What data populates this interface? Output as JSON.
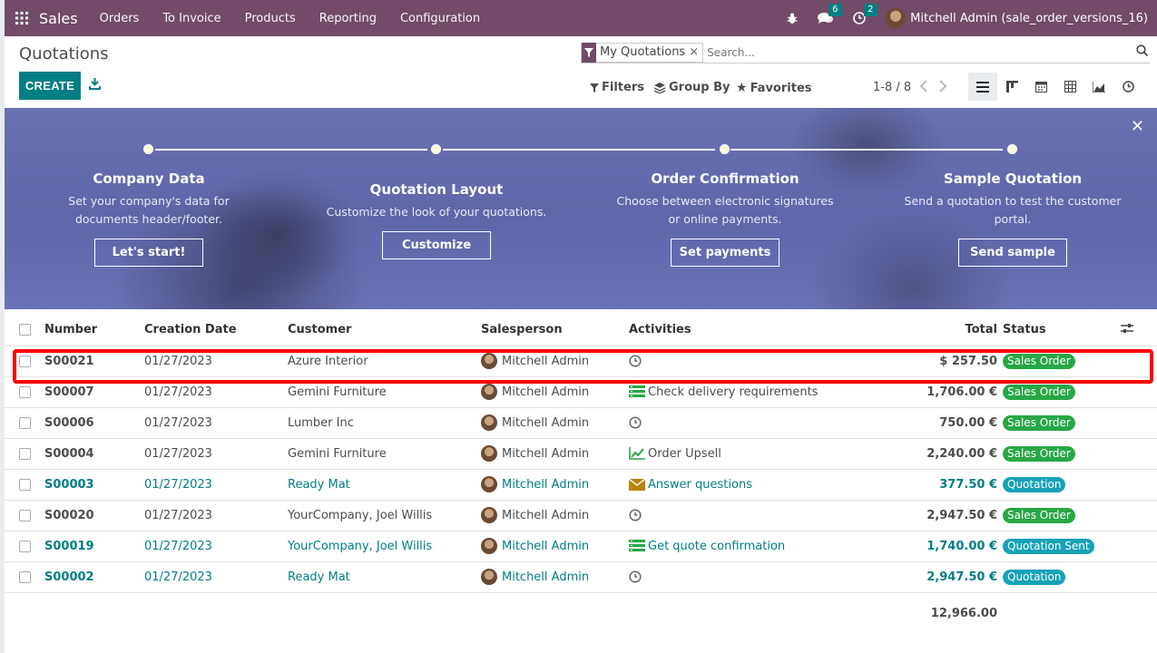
{
  "app": {
    "name": "Sales",
    "menu": [
      "Orders",
      "To Invoice",
      "Products",
      "Reporting",
      "Configuration"
    ]
  },
  "topbar": {
    "messages_count": "6",
    "activities_count": "2",
    "user": "Mitchell Admin (sale_order_versions_16)"
  },
  "page": {
    "title": "Quotations",
    "create_label": "CREATE"
  },
  "search": {
    "facet": "My Quotations",
    "placeholder": "Search..."
  },
  "filters": {
    "filters_label": "Filters",
    "groupby_label": "Group By",
    "favorites_label": "Favorites"
  },
  "pager": {
    "value": "1-8 / 8"
  },
  "banner": {
    "steps": [
      {
        "title": "Company Data",
        "desc": "Set your company's data for documents header/footer.",
        "button": "Let's start!"
      },
      {
        "title": "Quotation Layout",
        "desc": "Customize the look of your quotations.",
        "button": "Customize"
      },
      {
        "title": "Order Confirmation",
        "desc": "Choose between electronic signatures or online payments.",
        "button": "Set payments"
      },
      {
        "title": "Sample Quotation",
        "desc": "Send a quotation to test the customer portal.",
        "button": "Send sample"
      }
    ]
  },
  "table": {
    "headers": {
      "number": "Number",
      "date": "Creation Date",
      "customer": "Customer",
      "salesperson": "Salesperson",
      "activities": "Activities",
      "total": "Total",
      "status": "Status"
    },
    "rows": [
      {
        "number": "S00021",
        "date": "01/27/2023",
        "customer": "Azure Interior",
        "salesperson": "Mitchell Admin",
        "activity": "",
        "activity_icon": "clock-icon",
        "total": "$ 257.50",
        "status": "Sales Order",
        "status_color": "green",
        "teal": false
      },
      {
        "number": "S00007",
        "date": "01/27/2023",
        "customer": "Gemini Furniture",
        "salesperson": "Mitchell Admin",
        "activity": "Check delivery requirements",
        "activity_icon": "list-icon",
        "total": "1,706.00 €",
        "status": "Sales Order",
        "status_color": "green",
        "teal": false
      },
      {
        "number": "S00006",
        "date": "01/27/2023",
        "customer": "Lumber Inc",
        "salesperson": "Mitchell Admin",
        "activity": "",
        "activity_icon": "clock-icon",
        "total": "750.00 €",
        "status": "Sales Order",
        "status_color": "green",
        "teal": false
      },
      {
        "number": "S00004",
        "date": "01/27/2023",
        "customer": "Gemini Furniture",
        "salesperson": "Mitchell Admin",
        "activity": "Order Upsell",
        "activity_icon": "chart-icon",
        "total": "2,240.00 €",
        "status": "Sales Order",
        "status_color": "green",
        "teal": false
      },
      {
        "number": "S00003",
        "date": "01/27/2023",
        "customer": "Ready Mat",
        "salesperson": "Mitchell Admin",
        "activity": "Answer questions",
        "activity_icon": "envelope-icon",
        "total": "377.50 €",
        "status": "Quotation",
        "status_color": "blue",
        "teal": true
      },
      {
        "number": "S00020",
        "date": "01/27/2023",
        "customer": "YourCompany, Joel Willis",
        "salesperson": "Mitchell Admin",
        "activity": "",
        "activity_icon": "clock-icon",
        "total": "2,947.50 €",
        "status": "Sales Order",
        "status_color": "green",
        "teal": false
      },
      {
        "number": "S00019",
        "date": "01/27/2023",
        "customer": "YourCompany, Joel Willis",
        "salesperson": "Mitchell Admin",
        "activity": "Get quote confirmation",
        "activity_icon": "list-icon",
        "total": "1,740.00 €",
        "status": "Quotation Sent",
        "status_color": "blue",
        "teal": true
      },
      {
        "number": "S00002",
        "date": "01/27/2023",
        "customer": "Ready Mat",
        "salesperson": "Mitchell Admin",
        "activity": "",
        "activity_icon": "clock-icon",
        "total": "2,947.50 €",
        "status": "Quotation",
        "status_color": "blue",
        "teal": true
      }
    ],
    "sum_total": "12,966.00"
  },
  "colors": {
    "brand": "#714b67",
    "accent": "#017e84",
    "highlight": "#ff0000",
    "sales_order": "#28a745",
    "quotation": "#17a2b8"
  }
}
